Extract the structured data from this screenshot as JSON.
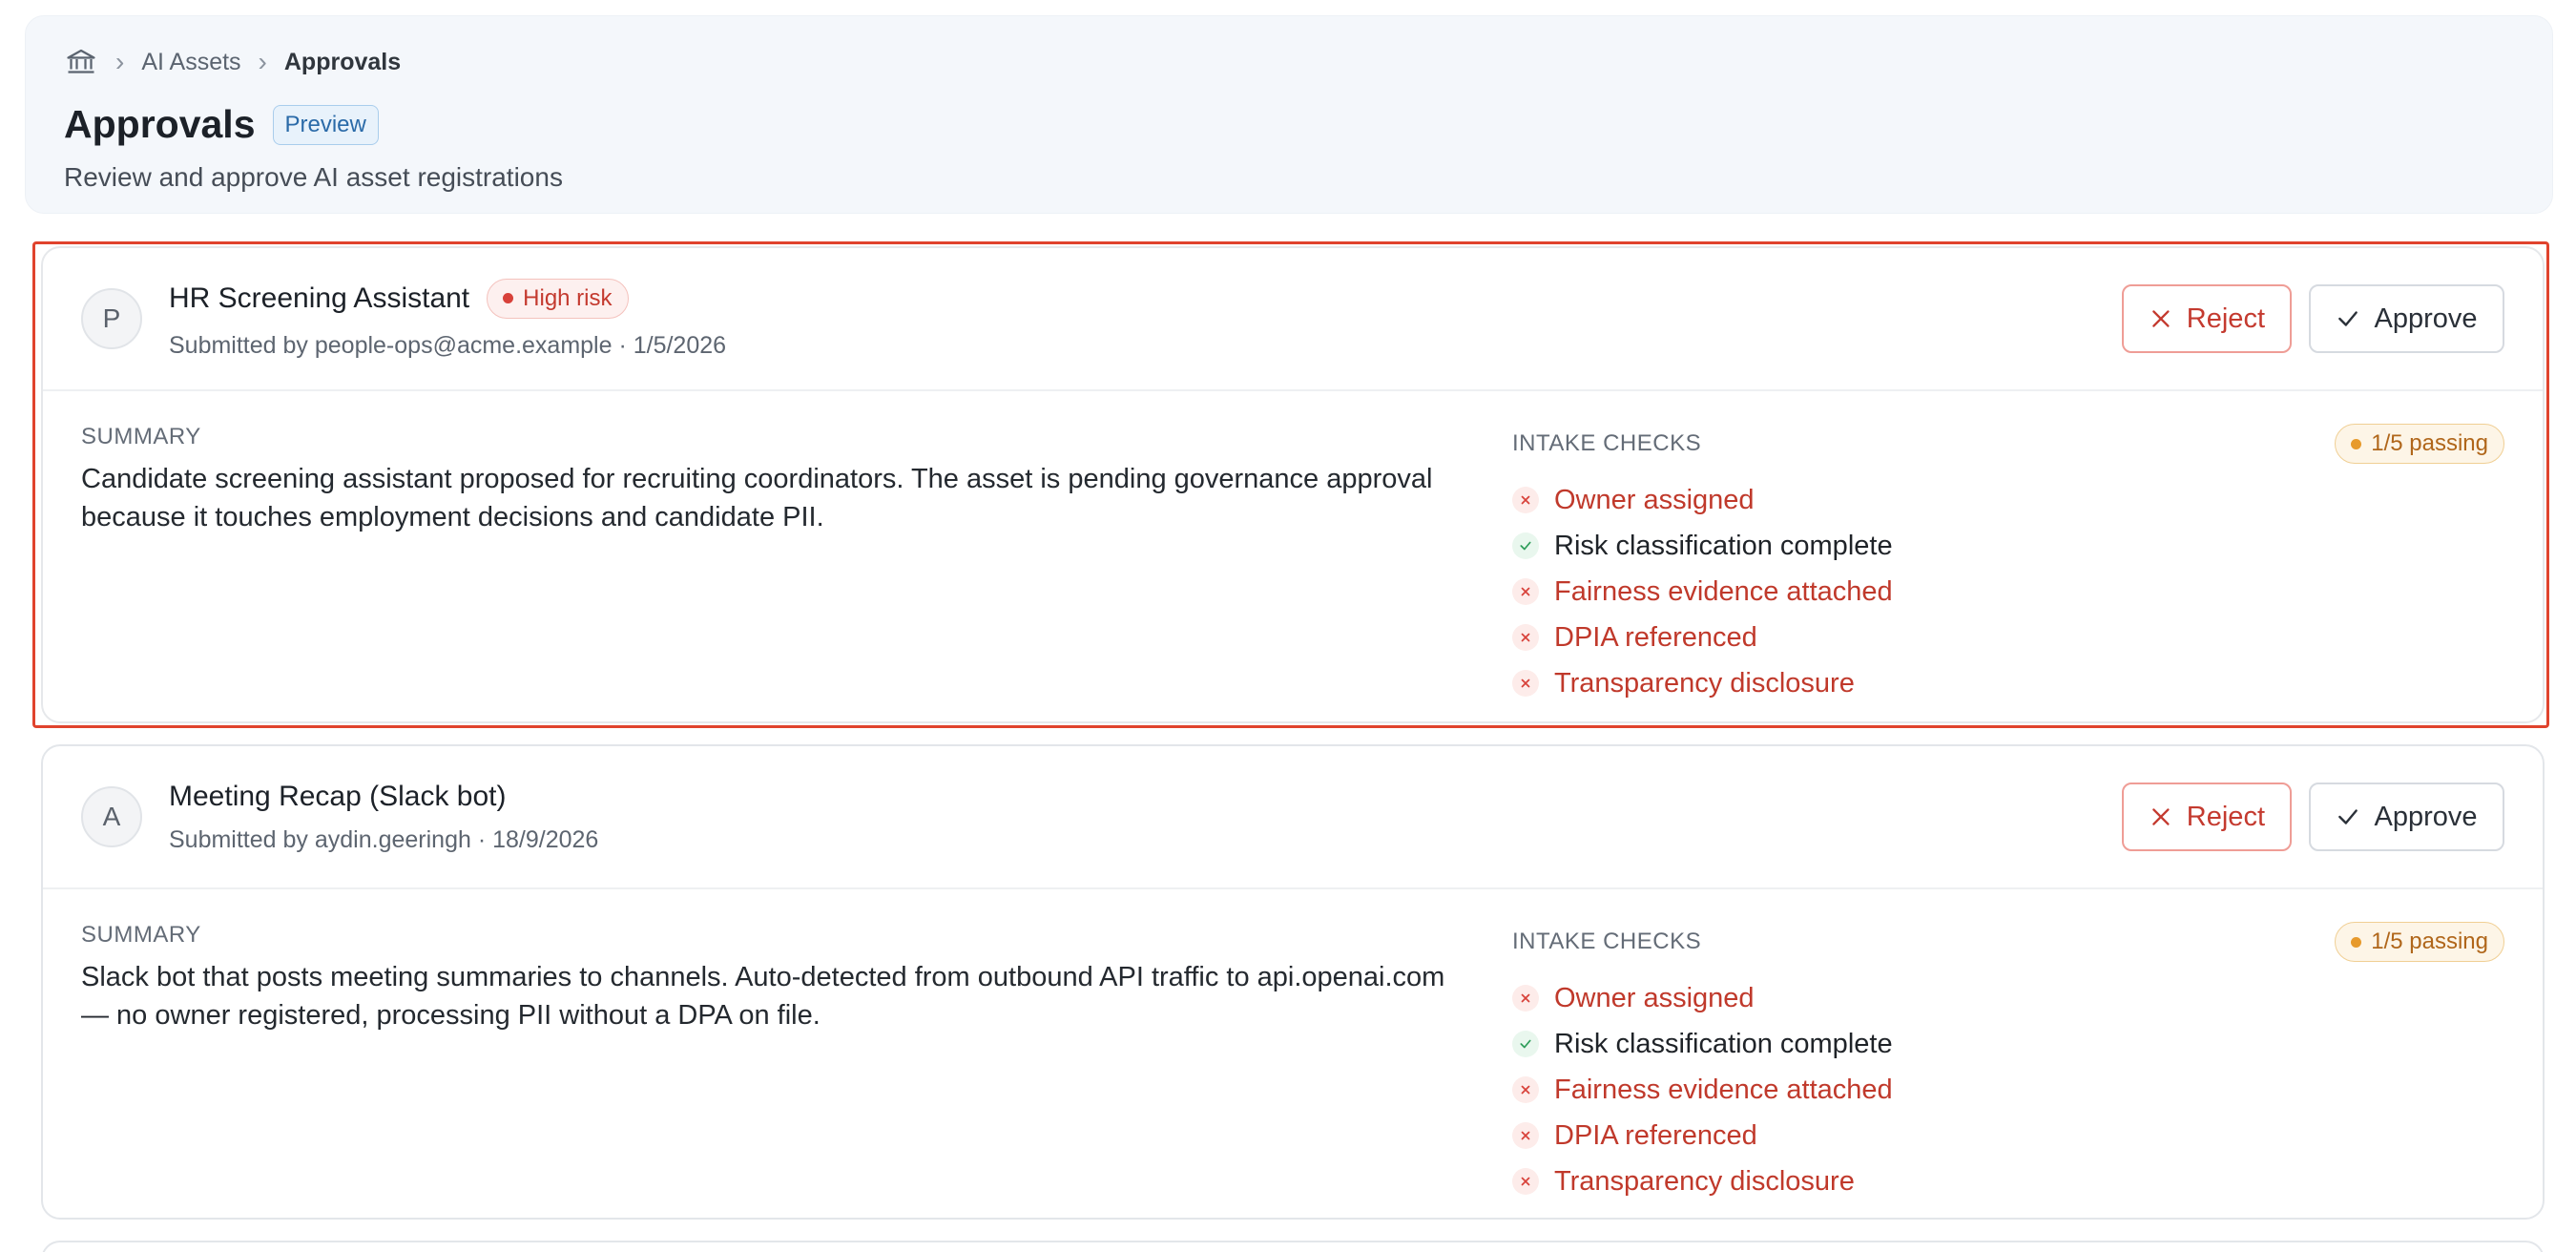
{
  "breadcrumb": {
    "home_icon": "bank-icon",
    "items": [
      "AI Assets",
      "Approvals"
    ]
  },
  "header": {
    "title": "Approvals",
    "badge": "Preview",
    "subtitle": "Review and approve AI asset registrations"
  },
  "labels": {
    "summary": "SUMMARY",
    "intake_checks": "INTAKE CHECKS",
    "reject": "Reject",
    "approve": "Approve"
  },
  "approvals": [
    {
      "avatar": "P",
      "name": "HR Screening Assistant",
      "risk": "High risk",
      "submitted": "Submitted by people-ops@acme.example · 1/5/2026",
      "summary": "Candidate screening assistant proposed for recruiting coordinators. The asset is pending governance approval because it touches employment decisions and candidate PII.",
      "passing": "1/5 passing",
      "checks": [
        {
          "label": "Owner assigned",
          "status": "fail"
        },
        {
          "label": "Risk classification complete",
          "status": "pass"
        },
        {
          "label": "Fairness evidence attached",
          "status": "fail"
        },
        {
          "label": "DPIA referenced",
          "status": "fail"
        },
        {
          "label": "Transparency disclosure",
          "status": "fail"
        }
      ]
    },
    {
      "avatar": "A",
      "name": "Meeting Recap (Slack bot)",
      "risk": "",
      "submitted": "Submitted by aydin.geeringh · 18/9/2026",
      "summary": "Slack bot that posts meeting summaries to channels. Auto-detected from outbound API traffic to api.openai.com — no owner registered, processing PII without a DPA on file.",
      "passing": "1/5 passing",
      "checks": [
        {
          "label": "Owner assigned",
          "status": "fail"
        },
        {
          "label": "Risk classification complete",
          "status": "pass"
        },
        {
          "label": "Fairness evidence attached",
          "status": "fail"
        },
        {
          "label": "DPIA referenced",
          "status": "fail"
        },
        {
          "label": "Transparency disclosure",
          "status": "fail"
        }
      ]
    }
  ],
  "colors": {
    "reject": "#c43a2f",
    "focus_ring": "#e0432d",
    "passing": "#b0661a",
    "pass_check": "#2f9e5b"
  }
}
